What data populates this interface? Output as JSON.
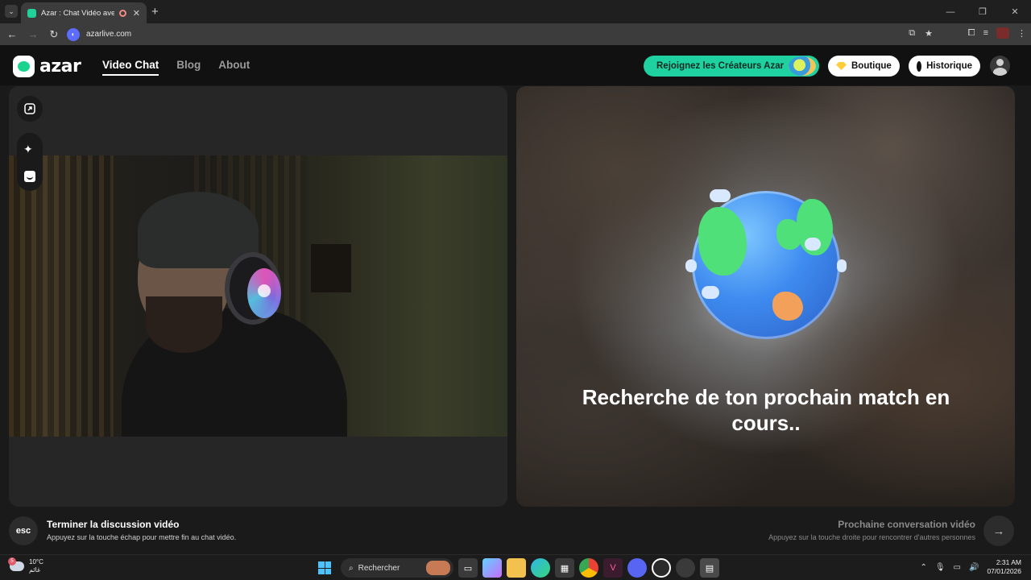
{
  "browser": {
    "tab_title": "Azar : Chat Vidéo avec de n",
    "tab_close": "✕",
    "new_tab": "+",
    "url": "azarlive.com"
  },
  "site": {
    "logo_text": "azar",
    "nav": [
      {
        "label": "Video Chat",
        "active": true
      },
      {
        "label": "Blog",
        "active": false
      },
      {
        "label": "About",
        "active": false
      }
    ],
    "cta_creators": "Rejoignez les Créateurs Azar",
    "boutique_label": "Boutique",
    "historique_label": "Historique"
  },
  "left_panel": {
    "icons": [
      "expand-icon",
      "sparkle-icon",
      "face-filter-icon"
    ]
  },
  "right_panel": {
    "searching_text": "Recherche de ton prochain match en cours.."
  },
  "controls": {
    "esc_label": "esc",
    "end_title": "Terminer la discussion vidéo",
    "end_subtitle": "Appuyez sur la touche échap pour mettre fin au chat vidéo.",
    "next_title": "Prochaine conversation vidéo",
    "next_subtitle": "Appuyez sur la touche droite pour rencontrer d'autres personnes",
    "next_arrow": "→"
  },
  "taskbar": {
    "weather_temp": "10°C",
    "weather_desc": "غائم",
    "weather_badge": "5",
    "search_label": "Rechercher",
    "time": "2:31 AM",
    "date": "07/01/2026"
  },
  "colors": {
    "accent_green": "#1fd1a0",
    "brand_green": "#19d38f"
  }
}
